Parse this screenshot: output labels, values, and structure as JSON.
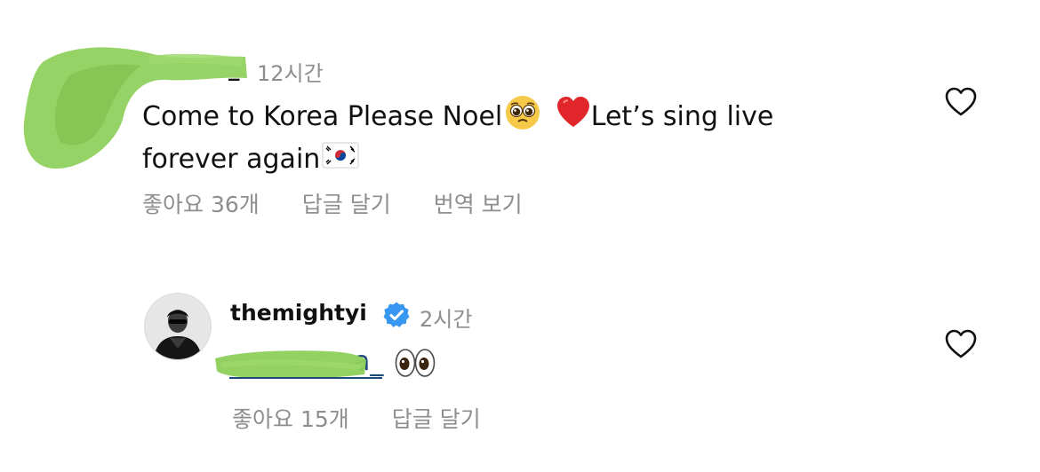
{
  "comment": {
    "username_visible_suffix": "_",
    "time": "12시간",
    "text_main": "Come to Korea Please Noel",
    "text_after_heart": "Let’s sing live",
    "text_line2": "forever again",
    "likes": "좋아요 36개",
    "reply": "답글 달기",
    "translate": "번역 보기",
    "icons": {
      "pleading": "pleading-face-emoji",
      "heart": "red-heart-emoji",
      "flag": "south-korea-flag-emoji",
      "like": "heart-outline-icon"
    }
  },
  "reply": {
    "username": "themightyi",
    "verified": true,
    "time": "2시간",
    "mention_suffix": "a_",
    "likes": "좋아요 15개",
    "reply": "답글 달기",
    "icons": {
      "eyes": "eyes-emoji",
      "like": "heart-outline-icon",
      "badge": "verified-badge-icon"
    }
  },
  "colors": {
    "text": "#111111",
    "muted": "#8e8e8e",
    "mention": "#1c4c7a",
    "verified": "#3897f0",
    "scribble": "#8ccf5a"
  }
}
